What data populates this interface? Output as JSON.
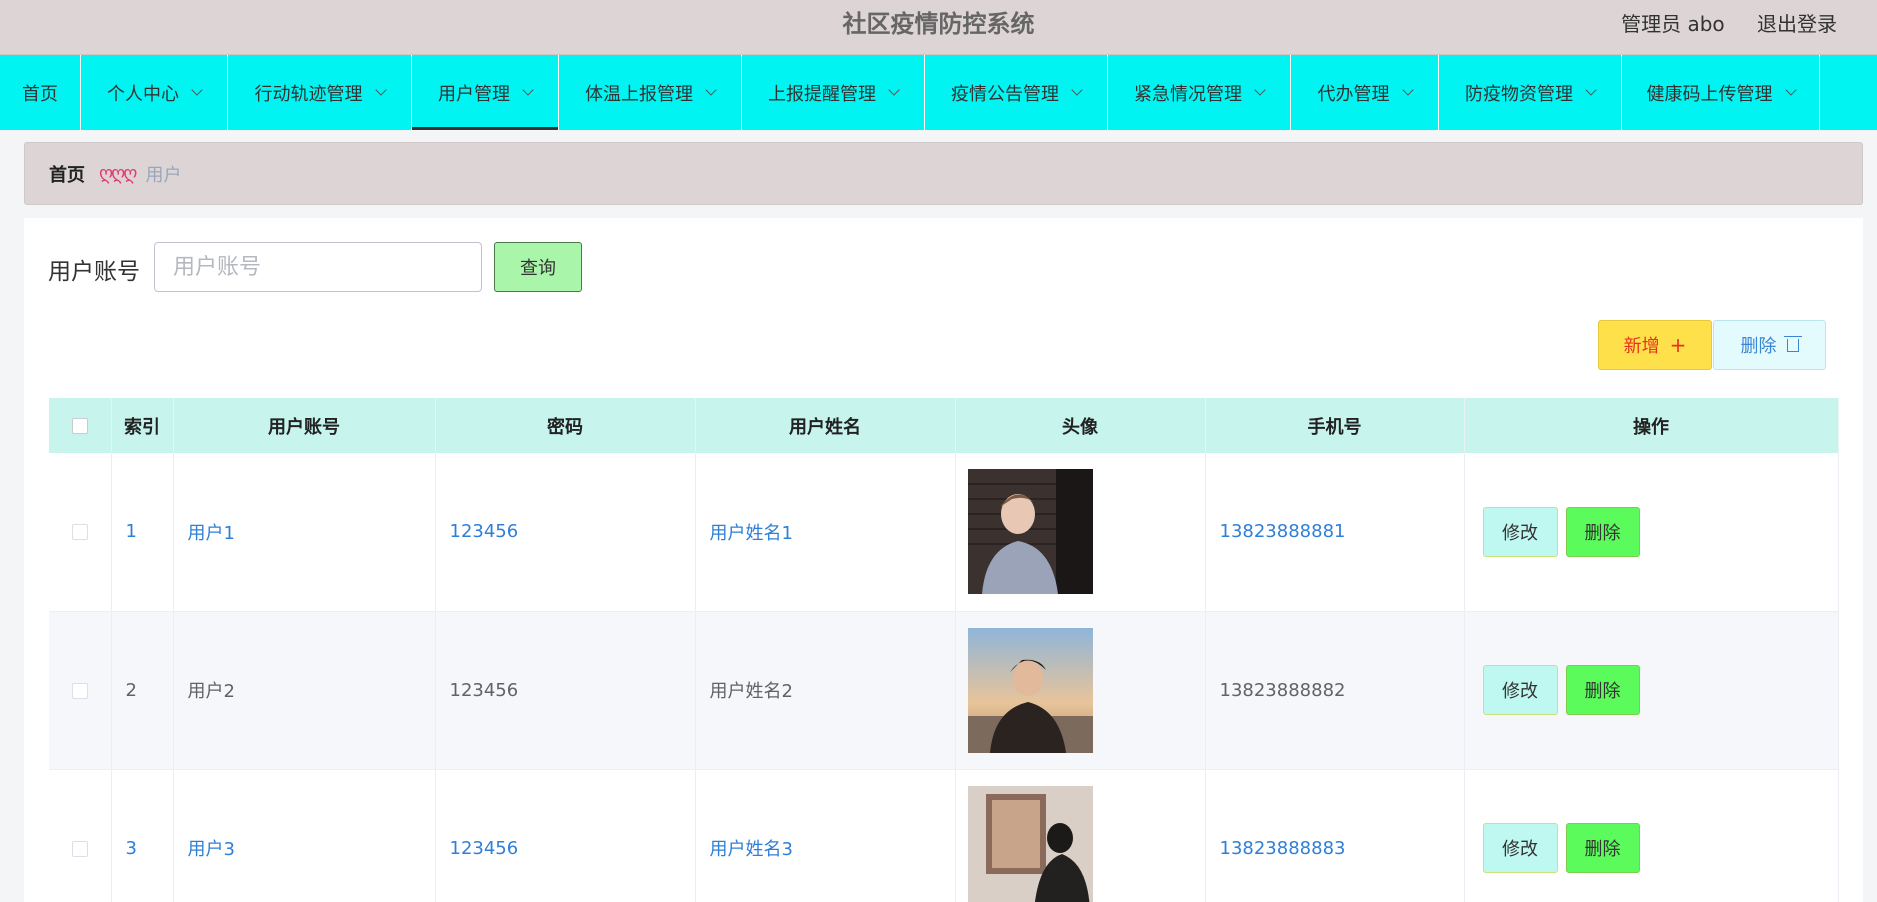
{
  "header": {
    "title": "社区疫情防控系统",
    "user_label": "管理员 abo",
    "logout_label": "退出登录"
  },
  "nav": {
    "items": [
      {
        "label": "首页",
        "dropdown": false
      },
      {
        "label": "个人中心",
        "dropdown": true
      },
      {
        "label": "行动轨迹管理",
        "dropdown": true
      },
      {
        "label": "用户管理",
        "dropdown": true,
        "active": true
      },
      {
        "label": "体温上报管理",
        "dropdown": true
      },
      {
        "label": "上报提醒管理",
        "dropdown": true
      },
      {
        "label": "疫情公告管理",
        "dropdown": true
      },
      {
        "label": "紧急情况管理",
        "dropdown": true
      },
      {
        "label": "代办管理",
        "dropdown": true
      },
      {
        "label": "防疫物资管理",
        "dropdown": true
      },
      {
        "label": "健康码上传管理",
        "dropdown": true
      }
    ]
  },
  "breadcrumb": {
    "home": "首页",
    "separator": "ღღღ",
    "current": "用户"
  },
  "search": {
    "label": "用户账号",
    "placeholder": "用户账号",
    "value": "",
    "button_label": "查询"
  },
  "actions": {
    "add_label": "新增",
    "add_icon": "plus-icon",
    "delete_label": "删除",
    "delete_icon": "trash-icon"
  },
  "table": {
    "columns": [
      "索引",
      "用户账号",
      "密码",
      "用户姓名",
      "头像",
      "手机号",
      "操作"
    ],
    "rows": [
      {
        "index": "1",
        "account": "用户1",
        "password": "123456",
        "name": "用户姓名1",
        "phone": "13823888881",
        "edit_label": "修改",
        "delete_label": "删除"
      },
      {
        "index": "2",
        "account": "用户2",
        "password": "123456",
        "name": "用户姓名2",
        "phone": "13823888882",
        "edit_label": "修改",
        "delete_label": "删除"
      },
      {
        "index": "3",
        "account": "用户3",
        "password": "123456",
        "name": "用户姓名3",
        "phone": "13823888883",
        "edit_label": "修改",
        "delete_label": "删除"
      }
    ]
  },
  "colors": {
    "nav_bg": "#00f5f2",
    "header_bg": "#ddd5d5",
    "table_header_bg": "#c7f5ee",
    "link_blue": "#2f7fd8",
    "add_button_bg": "#fde04a",
    "delete_row_button_bg": "#5cfb5c",
    "edit_button_bg": "#bff8f0",
    "query_button_bg": "#a9f5a9"
  }
}
